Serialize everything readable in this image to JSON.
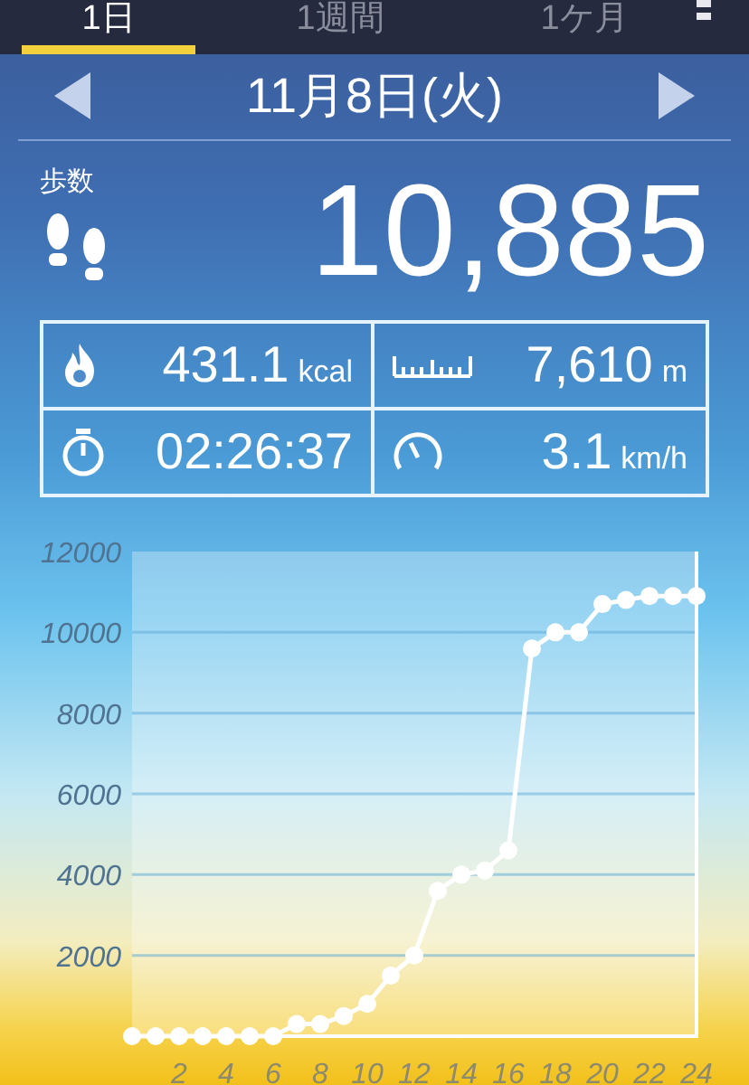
{
  "tabs": [
    {
      "label": "1日",
      "selected": true
    },
    {
      "label": "1週間",
      "selected": false
    },
    {
      "label": "1ケ月",
      "selected": false
    }
  ],
  "date": "11月8日(火)",
  "steps": {
    "label": "歩数",
    "value": "10,885"
  },
  "stats": [
    {
      "kind": "calories",
      "value": "431.1",
      "unit": "kcal"
    },
    {
      "kind": "distance",
      "value": "7,610",
      "unit": "m"
    },
    {
      "kind": "time",
      "value": "02:26:37"
    },
    {
      "kind": "speed",
      "value": "3.1",
      "unit": "km/h"
    }
  ],
  "chart": {
    "chart_data": {
      "type": "line",
      "x": [
        0,
        1,
        2,
        3,
        4,
        5,
        6,
        7,
        8,
        9,
        10,
        11,
        12,
        13,
        14,
        15,
        16,
        17,
        18,
        19,
        20,
        21,
        22,
        23,
        24
      ],
      "series": [
        {
          "color": "#ffffff",
          "marker": true,
          "values": [
            0,
            0,
            0,
            0,
            0,
            0,
            0,
            300,
            300,
            500,
            800,
            1500,
            2000,
            3600,
            4000,
            4100,
            4600,
            9600,
            10000,
            10000,
            10700,
            10800,
            10900,
            10900,
            10900
          ]
        }
      ],
      "grid": true,
      "xlim": [
        0,
        24
      ],
      "ylim": [
        0,
        12000
      ],
      "xticks": [
        2,
        4,
        6,
        8,
        10,
        12,
        14,
        16,
        18,
        20,
        22,
        24
      ],
      "yticks": [
        2000,
        4000,
        6000,
        8000,
        10000,
        12000
      ]
    }
  }
}
